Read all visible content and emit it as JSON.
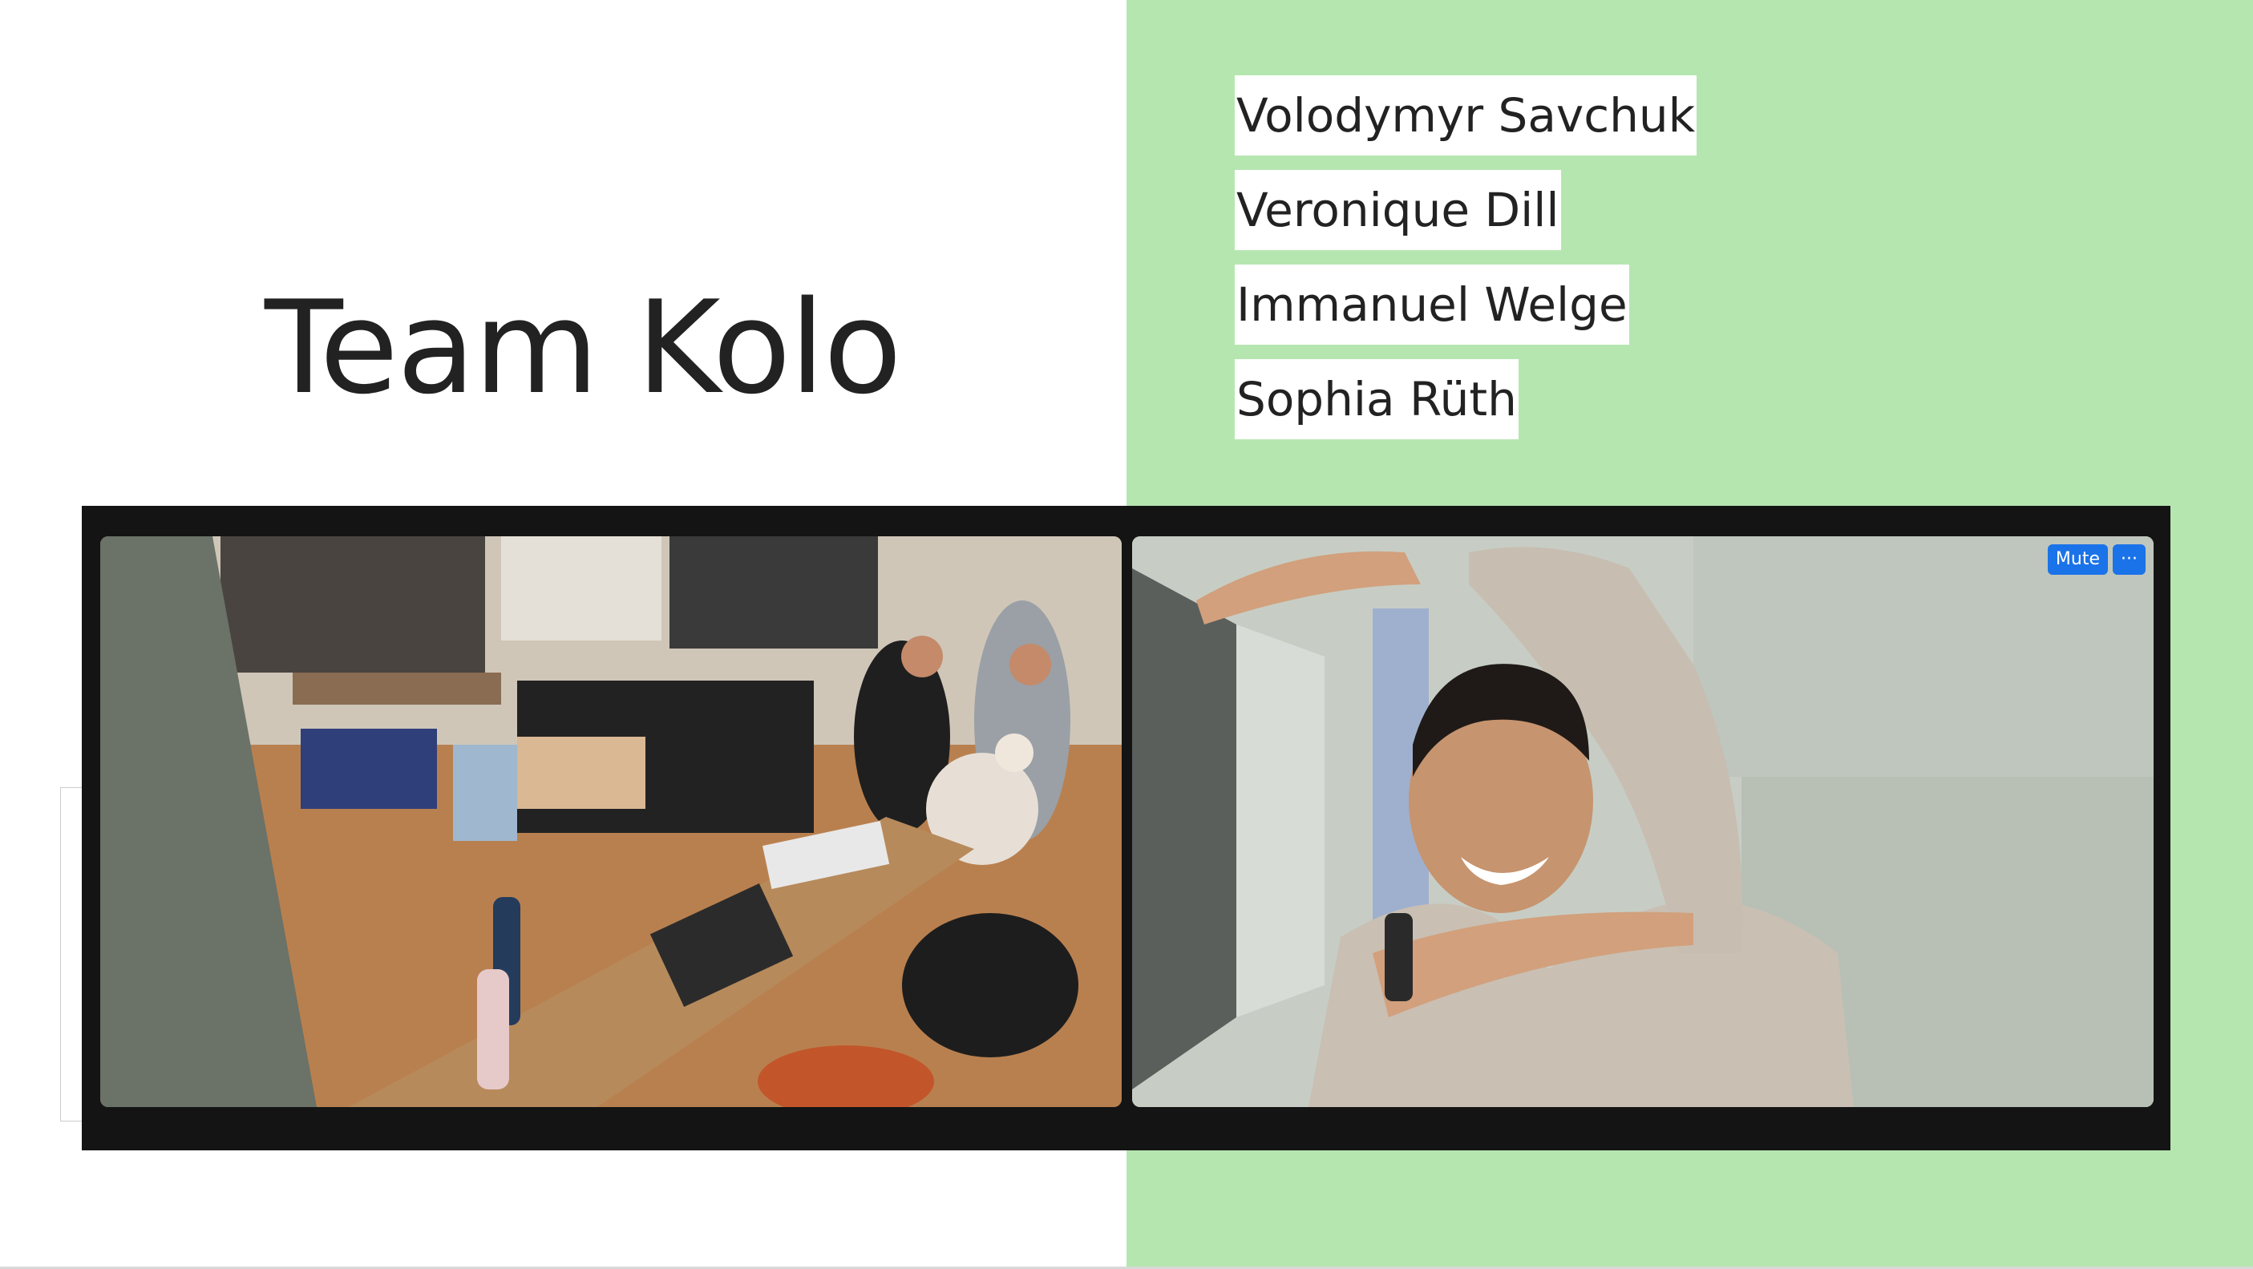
{
  "slide": {
    "title": "Team Kolo",
    "members": [
      "Volodymyr Savchuk",
      "Veronique Dill",
      "Immanuel Welge",
      "Sophia Rüth"
    ]
  },
  "video_call": {
    "controls": {
      "mute_label": "Mute",
      "more_label": "···"
    }
  },
  "colors": {
    "panel_green": "#b6e6b0",
    "video_strip": "#141414",
    "control_blue": "#1a73e8",
    "text": "#222222"
  }
}
